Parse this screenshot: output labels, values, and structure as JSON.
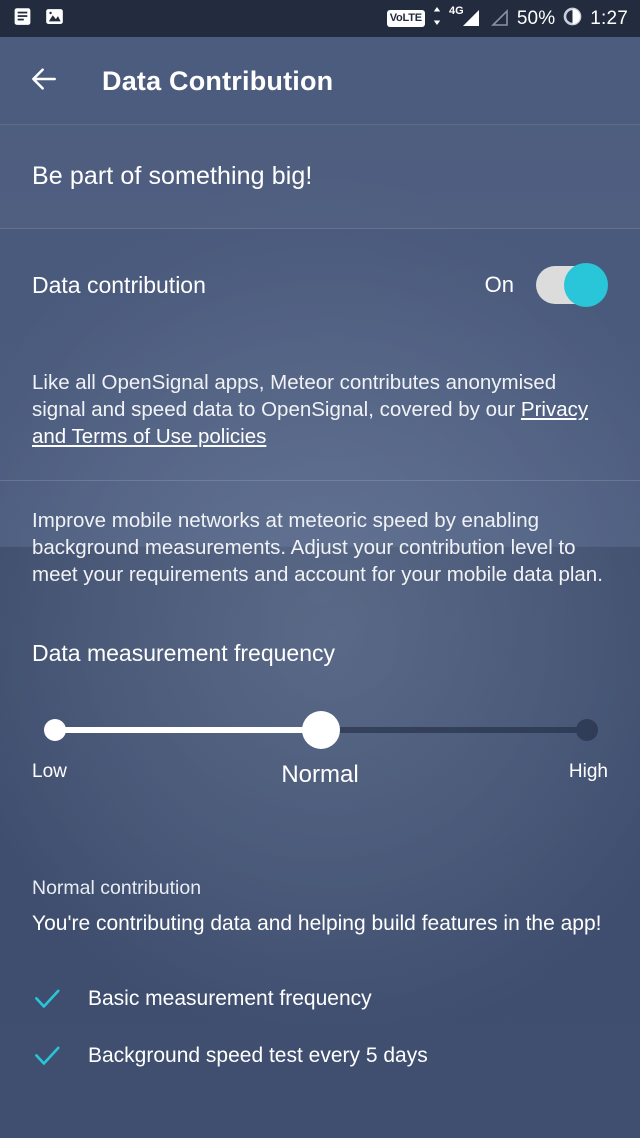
{
  "status_bar": {
    "notification_icons": [
      "message-icon",
      "image-icon"
    ],
    "volte_label": "VoLTE",
    "network_type": "4G",
    "battery_percent": "50%",
    "time": "1:27"
  },
  "app_bar": {
    "back_icon": "arrow-left-icon",
    "title": "Data Contribution"
  },
  "hero": {
    "headline": "Be part of something big!"
  },
  "toggle": {
    "label": "Data contribution",
    "state": "On",
    "checked": true,
    "accent_color": "#29c5d9"
  },
  "privacy": {
    "text_before": "Like all OpenSignal apps, Meteor contributes anonymised signal and speed data to OpenSignal, covered by our ",
    "link_text": "Privacy and Terms of Use policies"
  },
  "description": {
    "text": "Improve mobile networks at meteoric speed by enabling background measurements. Adjust your contribution level to meet your requirements and account for your mobile data plan."
  },
  "frequency": {
    "section_title": "Data measurement frequency",
    "slider": {
      "levels": [
        "Low",
        "Normal",
        "High"
      ],
      "selected_index": 1,
      "selected_label": "Normal",
      "low_label": "Low",
      "mid_label": "Normal",
      "high_label": "High"
    }
  },
  "summary": {
    "title": "Normal contribution",
    "subtitle": "You're contributing data and helping build features in the app!",
    "features": [
      {
        "icon": "check-icon",
        "label": "Basic measurement frequency"
      },
      {
        "icon": "check-icon",
        "label": "Background speed test every 5 days"
      }
    ]
  },
  "colors": {
    "status_bar_bg": "#232c3e",
    "app_bar_bg": "#4c5c7e",
    "page_bg": "#3d4c6b",
    "accent": "#29c5d9",
    "track_inactive": "#2d3a55"
  }
}
